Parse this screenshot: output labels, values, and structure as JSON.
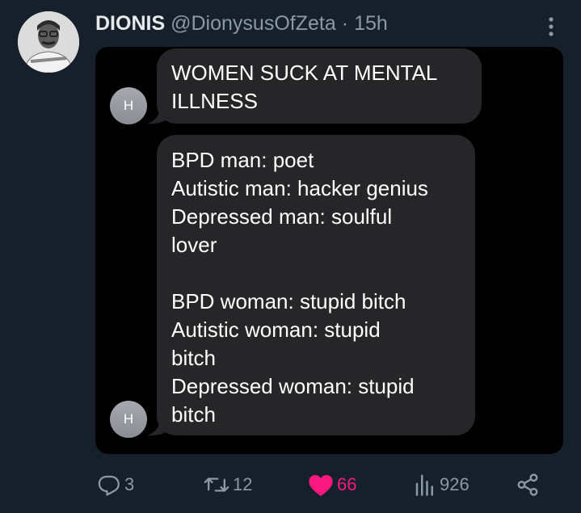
{
  "tweet": {
    "author": {
      "display_name": "DIONIS",
      "handle": "@DionysusOfZeta"
    },
    "separator": "·",
    "time": "15h",
    "avatar_icon": "user-avatar-photo"
  },
  "messages": {
    "contact_initial": "H",
    "bubble1": {
      "lines": [
        "WOMEN SUCK AT MENTAL",
        "ILLNESS"
      ]
    },
    "bubble2": {
      "lines": [
        "BPD man: poet",
        "Autistic man: hacker genius",
        "Depressed man: soulful",
        "lover",
        "",
        "BPD woman: stupid bitch",
        "Autistic woman: stupid",
        "bitch",
        "Depressed woman: stupid",
        "bitch"
      ]
    }
  },
  "actions": {
    "replies": "3",
    "retweets": "12",
    "likes": "66",
    "views": "926"
  },
  "colors": {
    "background": "#15202b",
    "like_active": "#f91880",
    "muted": "#8b98a5",
    "bubble": "#262628"
  }
}
